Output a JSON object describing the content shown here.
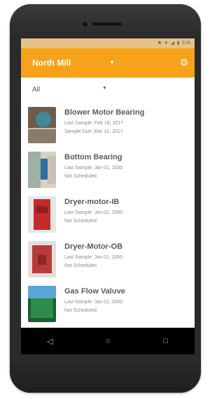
{
  "statusbar": {
    "time": "3:15"
  },
  "appbar": {
    "title": "North Mill"
  },
  "filter": {
    "value": "All"
  },
  "assets": [
    {
      "title": "Blower Motor Bearing",
      "line1": "Last Sample: Feb 18, 2017",
      "line2": "Sample Due: Mar 12, 2017",
      "colors": [
        "#6f5a4b",
        "#3e8a9a",
        "#c9c0b6"
      ]
    },
    {
      "title": "Bottom Bearing",
      "line1": "Last Sample: Jan 01, 2000",
      "line2": "Not Scheduled",
      "colors": [
        "#9fb0a5",
        "#2f6da2",
        "#d9d1c2"
      ]
    },
    {
      "title": "Dryer-motor-IB",
      "line1": "Last Sample: Jan 01, 2000",
      "line2": "Not Scheduled",
      "colors": [
        "#c42a2a",
        "#e6e6e6",
        "#8d1f1f"
      ]
    },
    {
      "title": "Dryer-Motor-OB",
      "line1": "Last Sample: Jan 01, 2000",
      "line2": "Not Scheduled",
      "colors": [
        "#b83a3a",
        "#e2dedc",
        "#8f2525"
      ]
    },
    {
      "title": "Gas Flow Valuve",
      "line1": "Last Sample: Jan 01, 2000",
      "line2": "Not Scheduled",
      "colors": [
        "#2f8b4b",
        "#5aa7d7",
        "#1d5e33"
      ]
    }
  ]
}
